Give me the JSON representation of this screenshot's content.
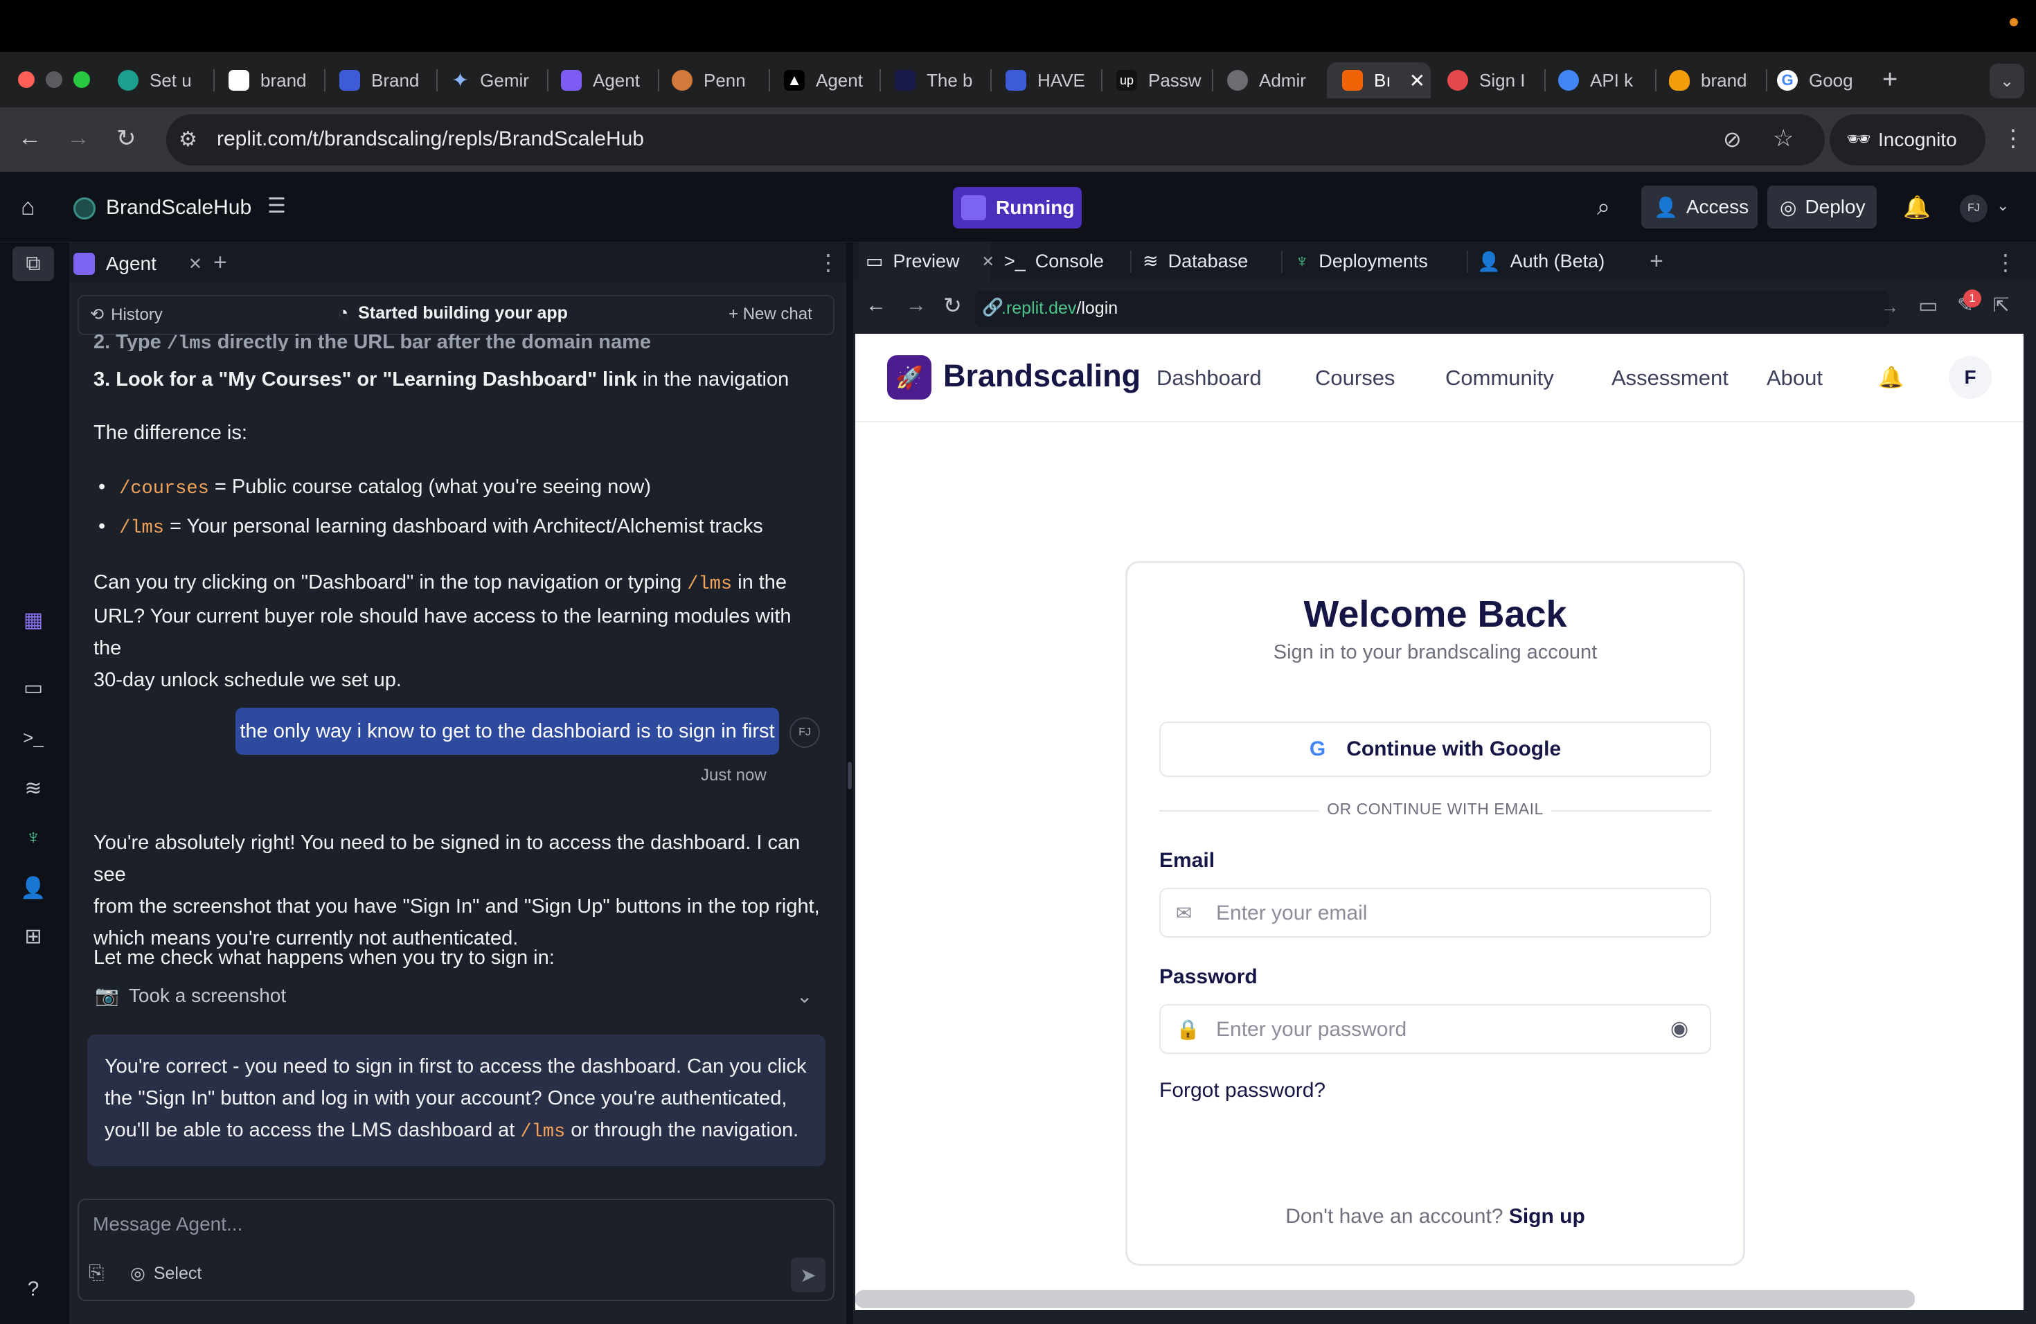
{
  "browser": {
    "tabs": [
      "Set u",
      "brand",
      "Brand",
      "Gemir",
      "Agent",
      "Penn",
      "Agent",
      "The b",
      "HAVE",
      "Passw",
      "Admir",
      "Bı",
      "Sign I",
      "API k",
      "brand",
      "Goog"
    ],
    "url": "replit.com/t/brandscaling/repls/BrandScaleHub",
    "incognito_label": "Incognito"
  },
  "header": {
    "project_name": "BrandScaleHub",
    "running_label": "Running",
    "access_label": "Access",
    "deploy_label": "Deploy",
    "avatar_initials": "FJ"
  },
  "agent": {
    "tab_label": "Agent",
    "history_label": "History",
    "status_label": "Started building your app",
    "new_chat_label": "New chat",
    "cut_line_prefix": "2. Type",
    "cut_line_code": "/lms",
    "cut_line_suffix": "directly in the URL bar after the domain name",
    "step3_bold": "3. Look for a \"My Courses\" or \"Learning Dashboard\" link",
    "step3_rest": " in the navigation",
    "difference": "The difference is:",
    "bullet1_code": "/courses",
    "bullet1_text": " = Public course catalog (what you're seeing now)",
    "bullet2_code": "/lms",
    "bullet2_text": " = Your personal learning dashboard with Architect/Alchemist tracks",
    "para1_a": "Can you try clicking on \"Dashboard\" in the top navigation or typing ",
    "para1_code": "/lms",
    "para1_b": " in the",
    "para1_c": "URL? Your current buyer role should have access to the learning modules with the",
    "para1_d": "30-day unlock schedule we set up.",
    "user_message": "the only way i know to get to the dashboiard is to sign in first",
    "user_initials": "FJ",
    "timestamp": "Just now",
    "para2_a": "You're absolutely right! You need to be signed in to access the dashboard. I can see",
    "para2_b": "from the screenshot that you have \"Sign In\" and \"Sign Up\" buttons in the top right,",
    "para2_c": "which means you're currently not authenticated.",
    "para3": "Let me check what happens when you try to sign in:",
    "screenshot_label": "Took a screenshot",
    "final_a": "You're correct - you need to sign in first to access the dashboard. Can you click",
    "final_b": "the \"Sign In\" button and log in with your account? Once you're authenticated,",
    "final_c": "you'll be able to access the LMS dashboard at ",
    "final_code": "/lms",
    "final_d": " or through the navigation.",
    "input_placeholder": "Message Agent...",
    "select_label": "Select"
  },
  "tools": {
    "tabs": [
      "Preview",
      "Console",
      "Database",
      "Deployments",
      "Auth (Beta)"
    ],
    "preview_url_host": ".replit.dev",
    "preview_url_path": "/login",
    "notification_count": "1"
  },
  "site": {
    "brand": "Brandscaling",
    "nav": [
      "Dashboard",
      "Courses",
      "Community",
      "Assessment",
      "About"
    ],
    "avatar": "F",
    "title": "Welcome Back",
    "subtitle": "Sign in to your brandscaling account",
    "google_button": "Continue with Google",
    "divider": "OR CONTINUE WITH EMAIL",
    "email_label": "Email",
    "email_placeholder": "Enter your email",
    "password_label": "Password",
    "password_placeholder": "Enter your password",
    "forgot": "Forgot password?",
    "no_account": "Don't have an account? ",
    "sign_up": "Sign up"
  },
  "colors": {
    "accent_purple": "#5b34c9",
    "brand_purple": "#4b1d8f",
    "navy": "#161646",
    "code_orange": "#f3a45a"
  }
}
